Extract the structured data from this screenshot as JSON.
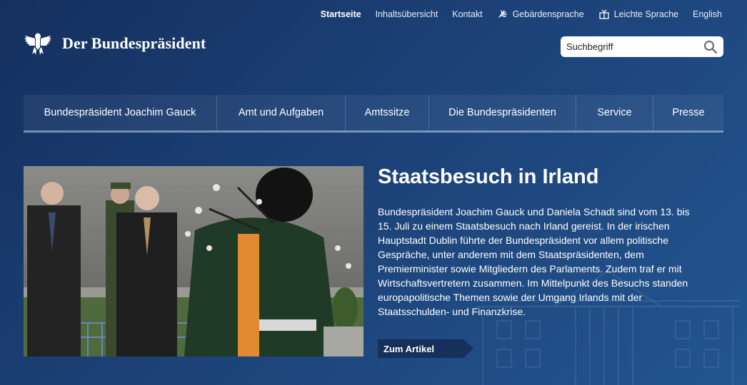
{
  "meta_nav": {
    "items": [
      {
        "label": "Startseite"
      },
      {
        "label": "Inhaltsübersicht"
      },
      {
        "label": "Kontakt"
      },
      {
        "label": "Gebärdensprache"
      },
      {
        "label": "Leichte Sprache"
      },
      {
        "label": "English"
      }
    ]
  },
  "logo": {
    "text": "Der Bundespräsident"
  },
  "search": {
    "placeholder": "Suchbegriff"
  },
  "main_nav": {
    "items": [
      {
        "label": "Bundespräsident Joachim Gauck"
      },
      {
        "label": "Amt und Aufgaben"
      },
      {
        "label": "Amtssitze"
      },
      {
        "label": "Die Bundespräsidenten"
      },
      {
        "label": "Service"
      },
      {
        "label": "Presse"
      }
    ]
  },
  "teaser": {
    "title": "Staatsbesuch in Irland",
    "text": "Bundespräsident Joachim Gauck und Daniela Schadt sind vom 13. bis 15. Juli zu einem Staatsbesuch nach Irland gereist. In der irischen Hauptstadt Dublin führte der Bundespräsident vor allem politische Gespräche, unter anderem mit dem Staatspräsidenten, dem Premierminister sowie Mitgliedern des Parlaments. Zudem traf er mit Wirtschaftsvertretern zusammen. Im Mittelpunkt des Besuchs standen europapolitische Themen sowie der Umgang Irlands mit der Staatsschulden- und Finanzkrise.",
    "link_label": "Zum Artikel"
  },
  "colors": {
    "background": "#1c4177",
    "nav_accent": "#a9c3e6",
    "link_button": "#15305a"
  }
}
